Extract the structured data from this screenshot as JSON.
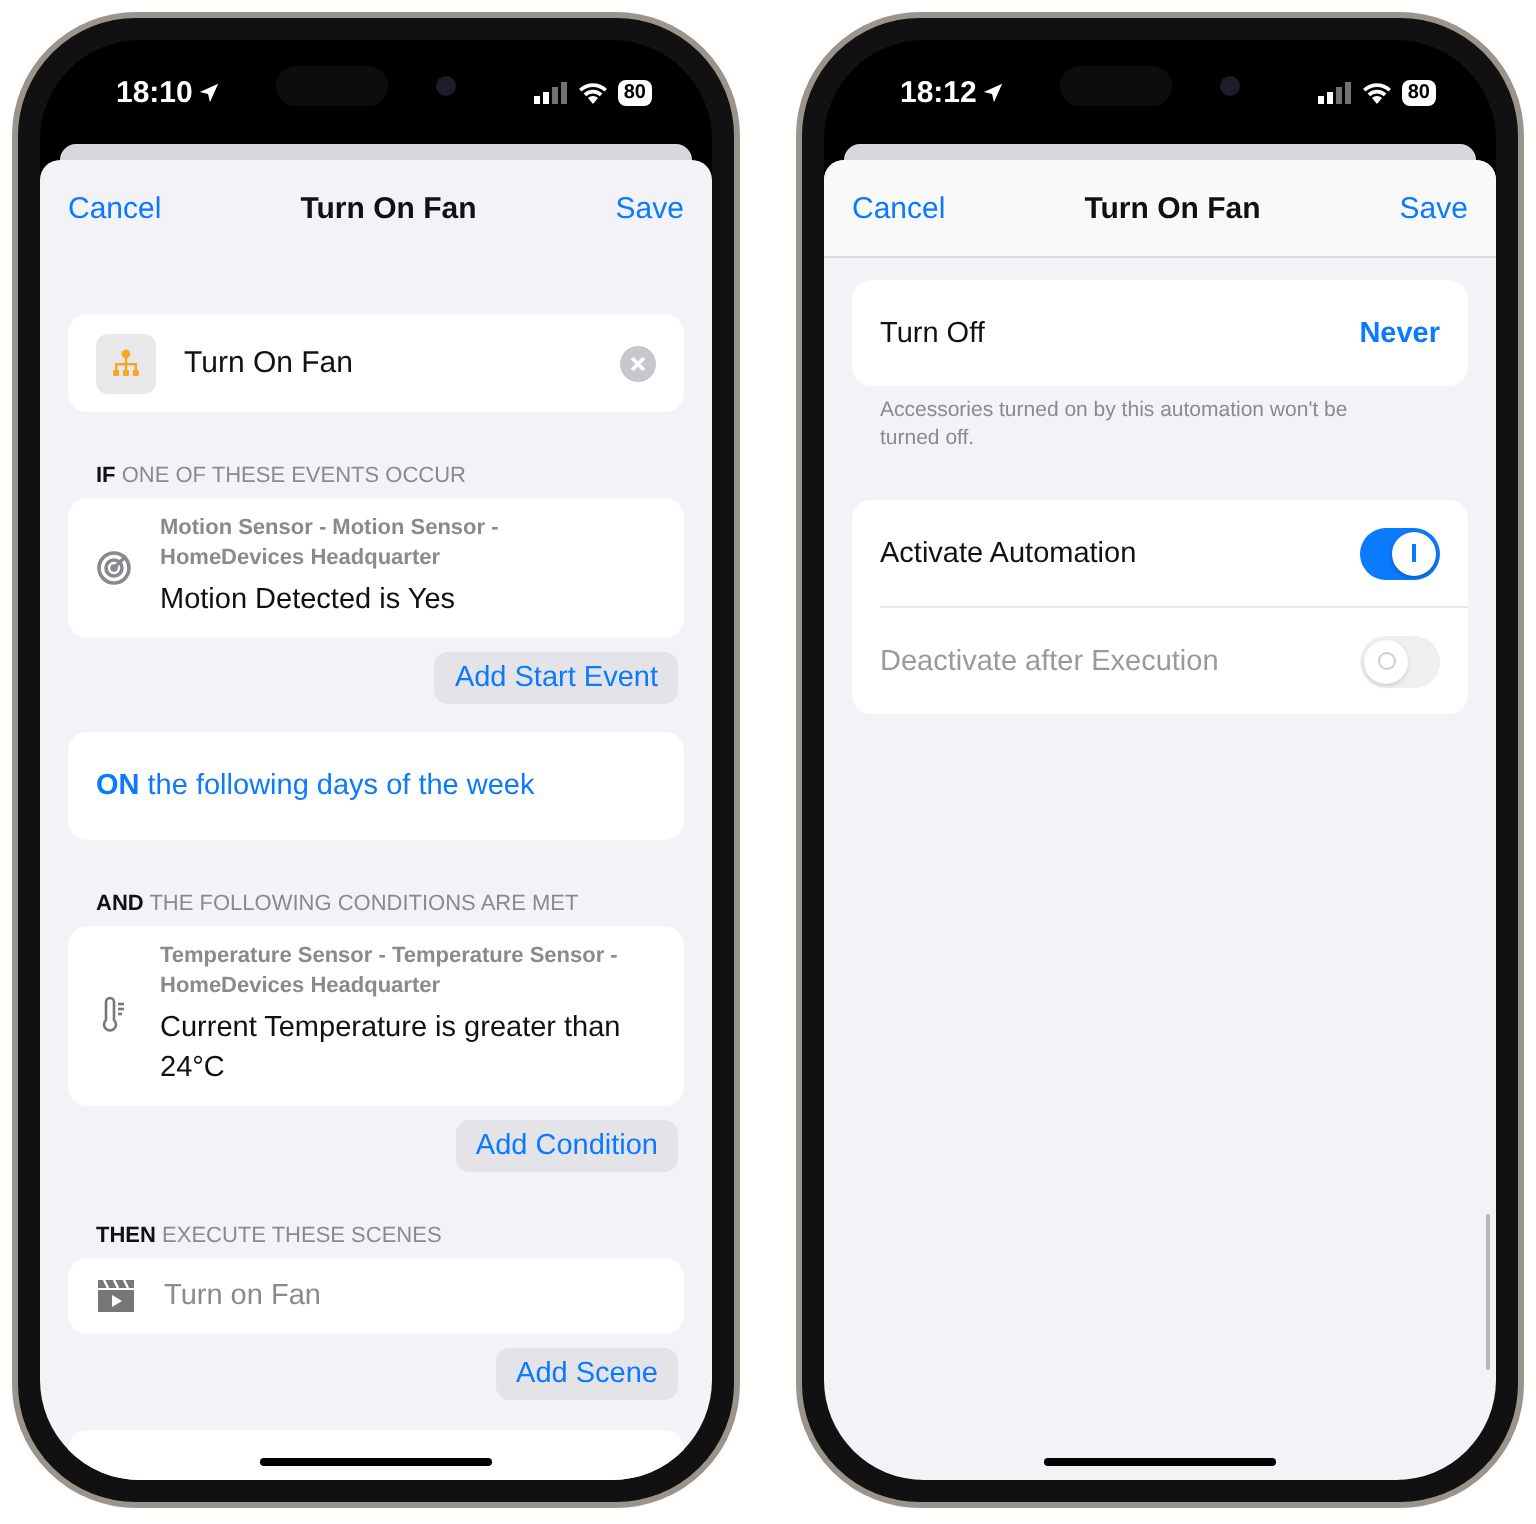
{
  "phones": [
    {
      "status": {
        "time": "18:10",
        "battery": "80"
      },
      "nav": {
        "cancel": "Cancel",
        "title": "Turn On Fan",
        "save": "Save",
        "separator": false
      },
      "scrollbar": false,
      "sections": [
        {
          "kind": "name",
          "value": "Turn On Fan"
        },
        {
          "kind": "header",
          "bold": "IF",
          "rest": "ONE OF THESE EVENTS OCCUR"
        },
        {
          "kind": "device",
          "device": "Motion Sensor - Motion Sensor - HomeDevices Headquarter",
          "condition": "Motion Detected is Yes"
        },
        {
          "kind": "action",
          "label": "Add Start Event"
        },
        {
          "kind": "link",
          "bold": "ON",
          "rest": "the following days of the week"
        },
        {
          "kind": "header",
          "bold": "AND",
          "rest": "THE FOLLOWING CONDITIONS ARE MET"
        },
        {
          "kind": "device",
          "device": "Temperature Sensor - Temperature Sensor - HomeDevices Headquarter",
          "condition": "Current Temperature is greater than 24°C"
        },
        {
          "kind": "action",
          "label": "Add Condition"
        },
        {
          "kind": "header",
          "bold": "THEN",
          "rest": "EXECUTE THESE SCENES"
        },
        {
          "kind": "scene",
          "label": "Turn on Fan"
        },
        {
          "kind": "action",
          "label": "Add Scene"
        },
        {
          "kind": "peek"
        }
      ]
    },
    {
      "status": {
        "time": "18:12",
        "battery": "80"
      },
      "nav": {
        "cancel": "Cancel",
        "title": "Turn On Fan",
        "save": "Save",
        "separator": true
      },
      "scrollbar": true,
      "sections": [
        {
          "kind": "value_row",
          "label": "Turn Off",
          "value": "Never"
        },
        {
          "kind": "footnote",
          "text": "Accessories turned on by this automation won't be turned off."
        },
        {
          "kind": "toggles",
          "rows": [
            {
              "label": "Activate Automation",
              "on": true,
              "disabled": false
            },
            {
              "label": "Deactivate after Execution",
              "on": false,
              "disabled": true
            }
          ]
        }
      ]
    }
  ]
}
